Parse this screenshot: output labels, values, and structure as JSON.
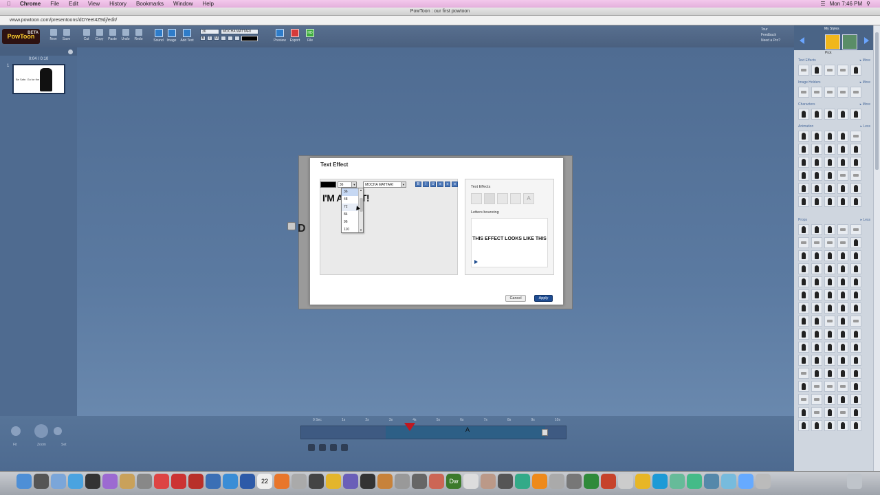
{
  "menubar": {
    "app": "Chrome",
    "items": [
      "File",
      "Edit",
      "View",
      "History",
      "Bookmarks",
      "Window",
      "Help"
    ],
    "clock": "Mon 7:46 PM"
  },
  "window": {
    "title": "PowToon : our first powtoon"
  },
  "browser": {
    "url": "www.powtoon.com/presentoons/dDYeet4Z9dj/edit/"
  },
  "toolbar": {
    "logo": "PowToon",
    "beta": "BETA",
    "new": "New",
    "save": "Save",
    "cut": "Cut",
    "copy": "Copy",
    "paste": "Paste",
    "undo": "Undo",
    "redo": "Redo",
    "sound": "Sound",
    "image": "Image",
    "add_text": "Add Text",
    "font_size": "36",
    "font_name": "MOCHA MATTARI",
    "bold": "B",
    "italic": "I",
    "underline": "U",
    "preview": "Preview",
    "export": "Export",
    "file": "File",
    "hd": "HD"
  },
  "help": {
    "tour": "Tour",
    "feedback": "Feedback",
    "need_pro": "Need a Pro?"
  },
  "slides": {
    "duration": "0:04 / 0:10",
    "number": "1",
    "thumb_text": "Be Safe. Go for the gold."
  },
  "stage": {
    "partial_text": "D"
  },
  "dialog": {
    "title": "Text Effect",
    "font_size": "36",
    "font": "MOCHA MATTARI",
    "fmt": [
      "B",
      "I",
      "U",
      "≡",
      "≡",
      "≡"
    ],
    "text": "I'M A",
    "text_tail": "T!",
    "size_options": [
      "36",
      "48",
      "72",
      "84",
      "96",
      "110"
    ],
    "effects_label": "Text Effects",
    "effect_name": "Letters bouncing",
    "preview_text": "THIS EFFECT LOOKS LIKE THIS",
    "effect_glyph": "A",
    "cancel": "Cancel",
    "apply": "Apply"
  },
  "right_panel": {
    "my_styles": "My Styles",
    "picker": "Pick",
    "text_effects": "Text Effects",
    "image_holders": "Image Holders",
    "characters": "Characters",
    "animation": "Animation",
    "props": "Props",
    "more": "▸ More",
    "less": "▸ Less"
  },
  "timeline": {
    "ticks": [
      "0 Sec",
      "1s",
      "2s",
      "3s",
      "4s",
      "5s",
      "6s",
      "7s",
      "8s",
      "9s",
      "10s"
    ],
    "marker": "A",
    "fit": "Fit",
    "zoom": "Zoom",
    "set": "Set"
  },
  "dock": {
    "calendar_day": "22",
    "dw": "Dw"
  }
}
